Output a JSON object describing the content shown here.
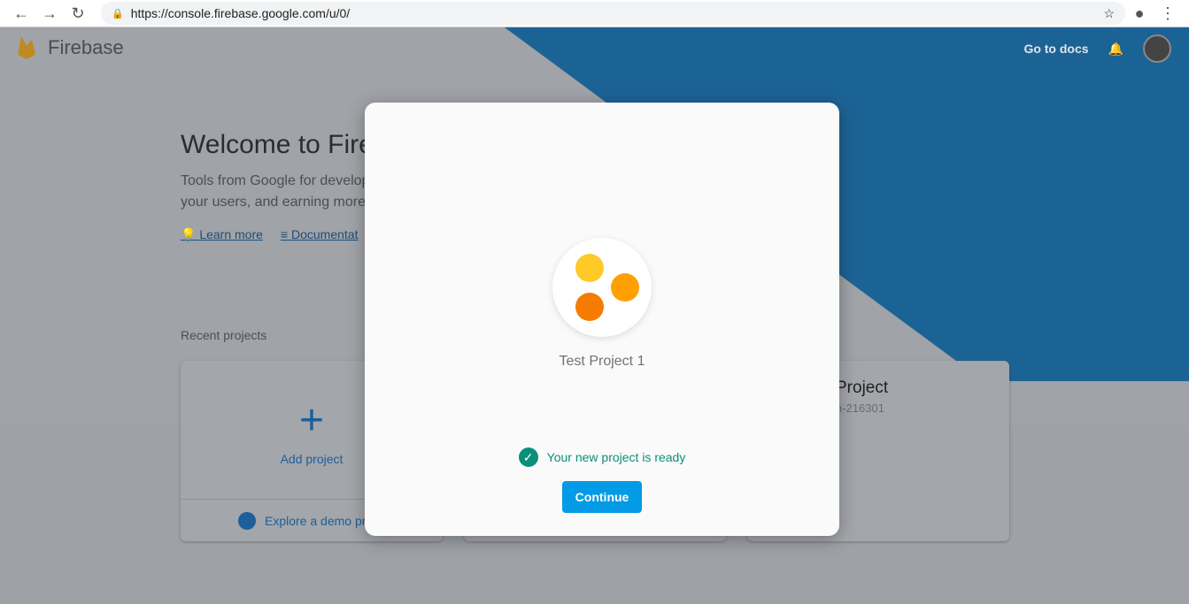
{
  "browser": {
    "url": "https://console.firebase.google.com/u/0/"
  },
  "header": {
    "brand": "Firebase",
    "docs_link": "Go to docs"
  },
  "hero": {
    "title": "Welcome to Fire",
    "line1": "Tools from Google for develop",
    "line2": "your users, and earning more",
    "learn_more": "Learn more",
    "documentation": "Documentat"
  },
  "recent": {
    "label": "Recent projects",
    "add_project": "Add project",
    "explore_demo": "Explore a demo pr",
    "project_title": "Project",
    "project_id": "n-216301"
  },
  "modal": {
    "project_name": "Test Project 1",
    "status": "Your new project is ready",
    "continue_label": "Continue",
    "colors": {
      "dot1": "#ffca28",
      "dot2": "#ffa000",
      "dot3": "#f57c00",
      "accent": "#039be5",
      "success": "#0b8f7c"
    }
  }
}
